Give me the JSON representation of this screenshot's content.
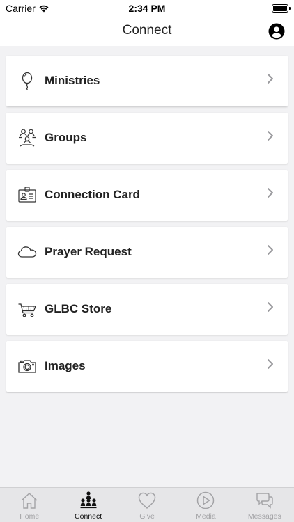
{
  "status_bar": {
    "carrier": "Carrier",
    "time": "2:34 PM"
  },
  "nav": {
    "title": "Connect",
    "profile_icon": "person-circle-icon"
  },
  "menu": [
    {
      "label": "Ministries",
      "icon": "balloon-icon"
    },
    {
      "label": "Groups",
      "icon": "people-group-icon"
    },
    {
      "label": "Connection Card",
      "icon": "id-card-icon"
    },
    {
      "label": "Prayer Request",
      "icon": "cloud-icon"
    },
    {
      "label": "GLBC Store",
      "icon": "shopping-cart-icon"
    },
    {
      "label": "Images",
      "icon": "camera-icon"
    }
  ],
  "tabs": [
    {
      "label": "Home",
      "icon": "home-icon",
      "active": false
    },
    {
      "label": "Connect",
      "icon": "connect-people-icon",
      "active": true
    },
    {
      "label": "Give",
      "icon": "heart-icon",
      "active": false
    },
    {
      "label": "Media",
      "icon": "play-circle-icon",
      "active": false
    },
    {
      "label": "Messages",
      "icon": "chat-bubbles-icon",
      "active": false
    }
  ],
  "colors": {
    "background": "#f2f2f4",
    "card": "#ffffff",
    "tab_bar": "#e6e6e8",
    "tab_inactive": "#a3a3a6",
    "tab_active": "#111111",
    "chevron": "#9a9a9e"
  }
}
